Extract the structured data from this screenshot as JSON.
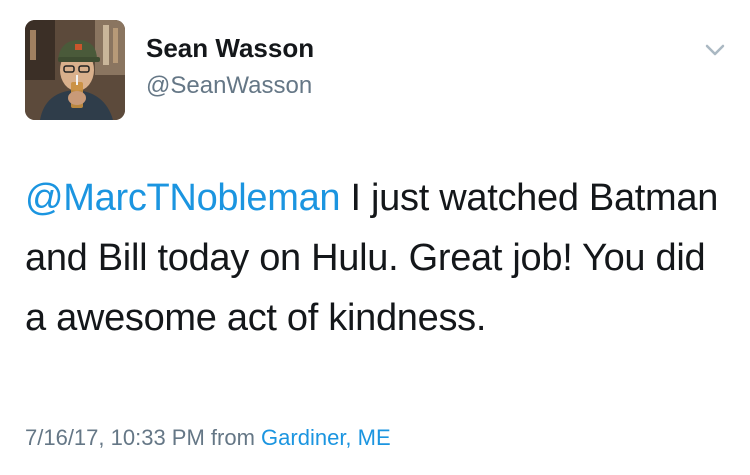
{
  "user": {
    "display_name": "Sean Wasson",
    "handle": "@SeanWasson"
  },
  "tweet": {
    "mention": "@MarcTNobleman",
    "body": "I just watched Batman and Bill today on Hulu. Great job! You did a awesome act of kindness."
  },
  "meta": {
    "timestamp": "7/16/17, 10:33 PM",
    "from_label": "from",
    "location": "Gardiner, ME"
  },
  "icons": {
    "menu": "chevron-down-icon"
  },
  "colors": {
    "link": "#1b95e0",
    "text": "#14171a",
    "secondary": "#657786"
  }
}
